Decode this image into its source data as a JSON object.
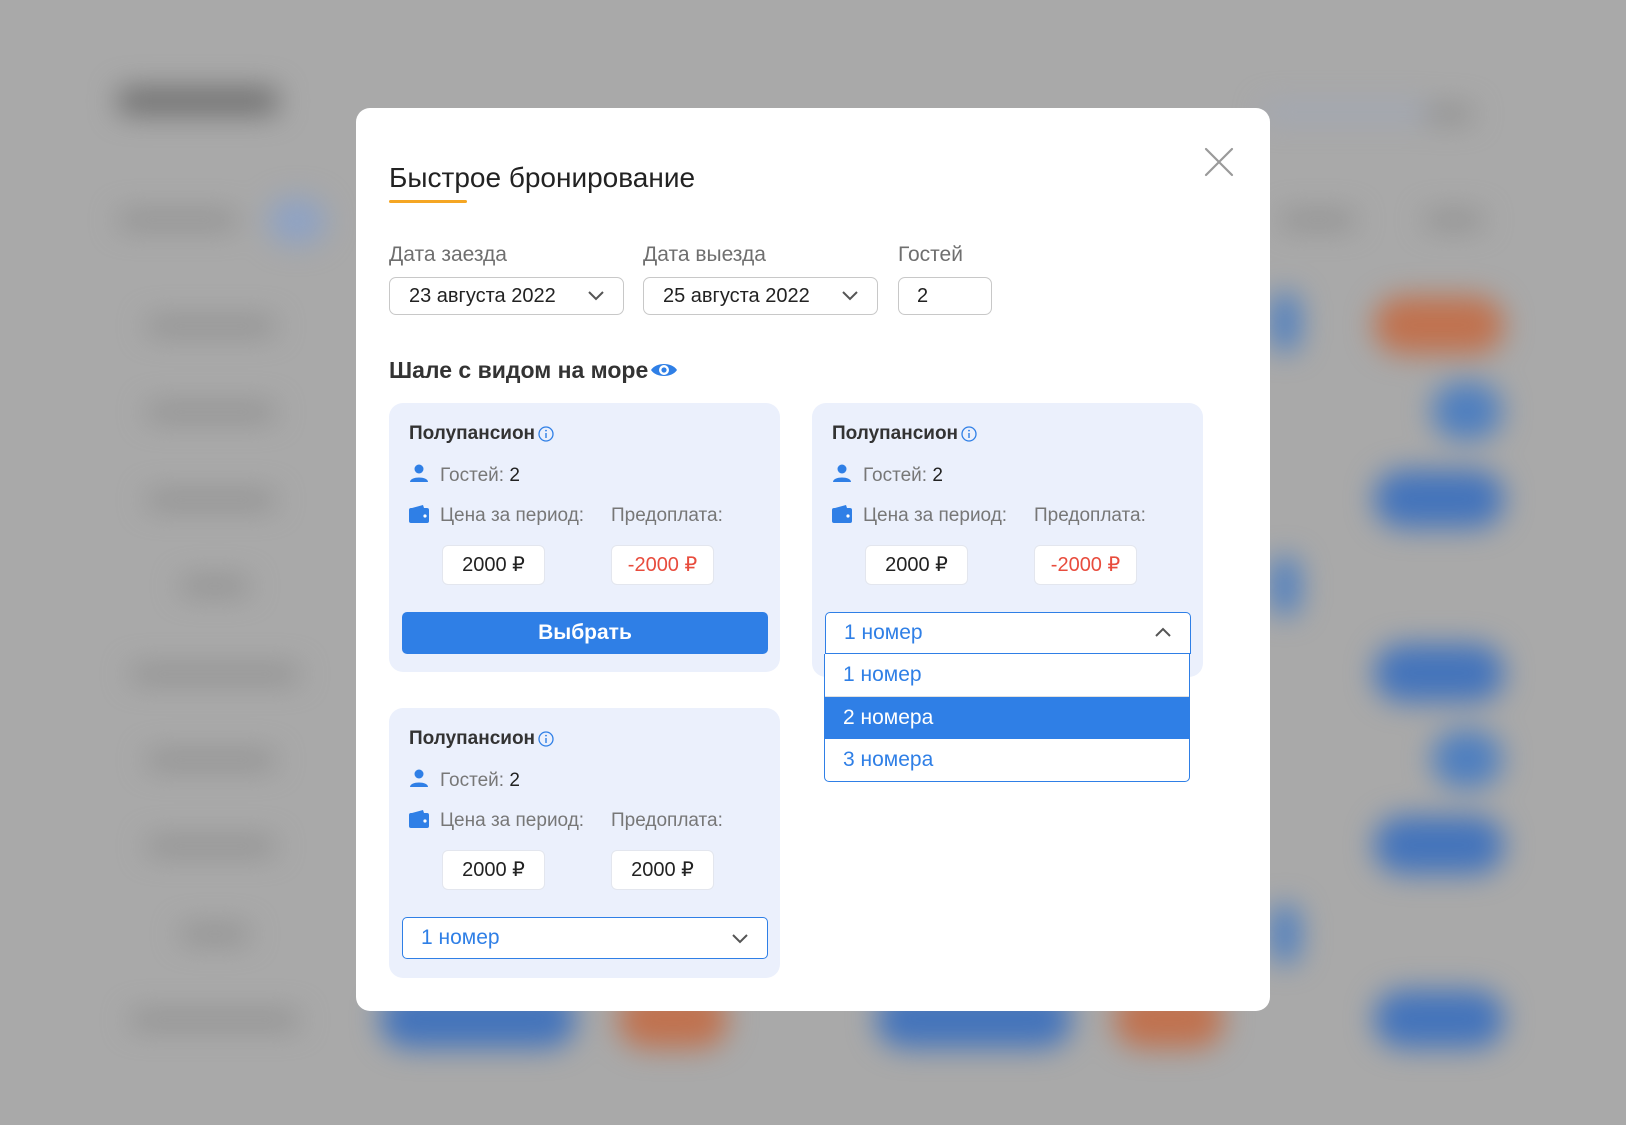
{
  "modal": {
    "title": "Быстрое бронирование",
    "checkin": {
      "label": "Дата заезда",
      "value": "23 августа 2022"
    },
    "checkout": {
      "label": "Дата выезда",
      "value": "25 августа 2022"
    },
    "guests": {
      "label": "Гостей",
      "value": "2"
    },
    "room_title": "Шале с видом на море",
    "cards": [
      {
        "name": "Полупансион",
        "guests_label": "Гостей:",
        "guests_value": "2",
        "price_label": "Цена за период:",
        "prepay_label": "Предоплата:",
        "price": "2000 ₽",
        "prepay": "-2000 ₽",
        "action": "Выбрать"
      },
      {
        "name": "Полупансион",
        "guests_label": "Гостей:",
        "guests_value": "2",
        "price_label": "Цена за период:",
        "prepay_label": "Предоплата:",
        "price": "2000 ₽",
        "prepay": "-2000 ₽",
        "select_value": "1 номер",
        "options": [
          "1 номер",
          "2 номера",
          "3 номера"
        ],
        "highlighted_option": "2 номера"
      },
      {
        "name": "Полупансион",
        "guests_label": "Гостей:",
        "guests_value": "2",
        "price_label": "Цена за период:",
        "prepay_label": "Предоплата:",
        "price": "2000 ₽",
        "prepay": "2000 ₽",
        "select_value": "1 номер"
      }
    ]
  },
  "colors": {
    "accent": "#2f7fe6",
    "title_underline": "#f5a623",
    "negative": "#e84c3d",
    "card_bg": "#ebf0fc",
    "overlay": "#a9a9a9"
  },
  "icons": [
    "close-icon",
    "chevron-down-icon",
    "chevron-up-icon",
    "eye-icon",
    "info-icon",
    "user-icon",
    "wallet-icon"
  ]
}
